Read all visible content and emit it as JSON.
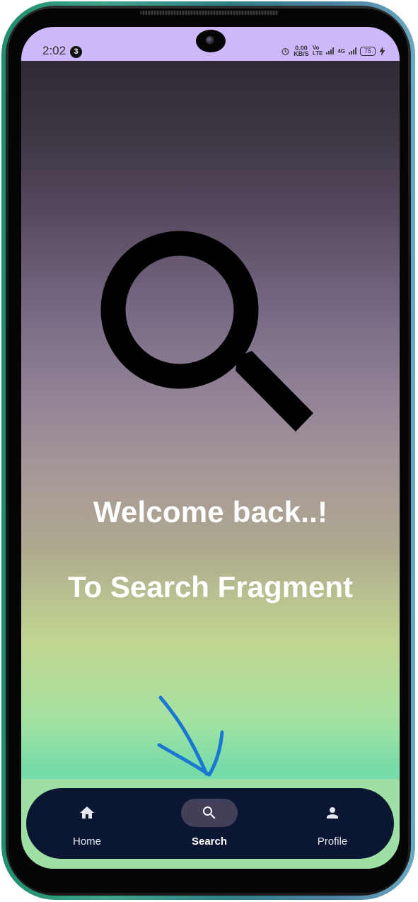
{
  "status_bar": {
    "time": "2:02",
    "notification_count": "3",
    "net_speed_value": "0.00",
    "net_speed_unit": "KB/S",
    "network_type": "4G",
    "battery_level": "75",
    "background_color": "#cdb8fb"
  },
  "main": {
    "hero_icon": "search-icon",
    "welcome_text": "Welcome back..!",
    "subtitle_text": "To Search Fragment"
  },
  "bottom_nav": {
    "background_color": "#0b1632",
    "active_pill_color": "#424058",
    "items": [
      {
        "label": "Home",
        "icon": "home-icon",
        "active": false
      },
      {
        "label": "Search",
        "icon": "search-icon",
        "active": true
      },
      {
        "label": "Profile",
        "icon": "person-icon",
        "active": false
      }
    ]
  },
  "annotation": {
    "icon": "arrow-down-icon",
    "color": "#1a77d2"
  }
}
